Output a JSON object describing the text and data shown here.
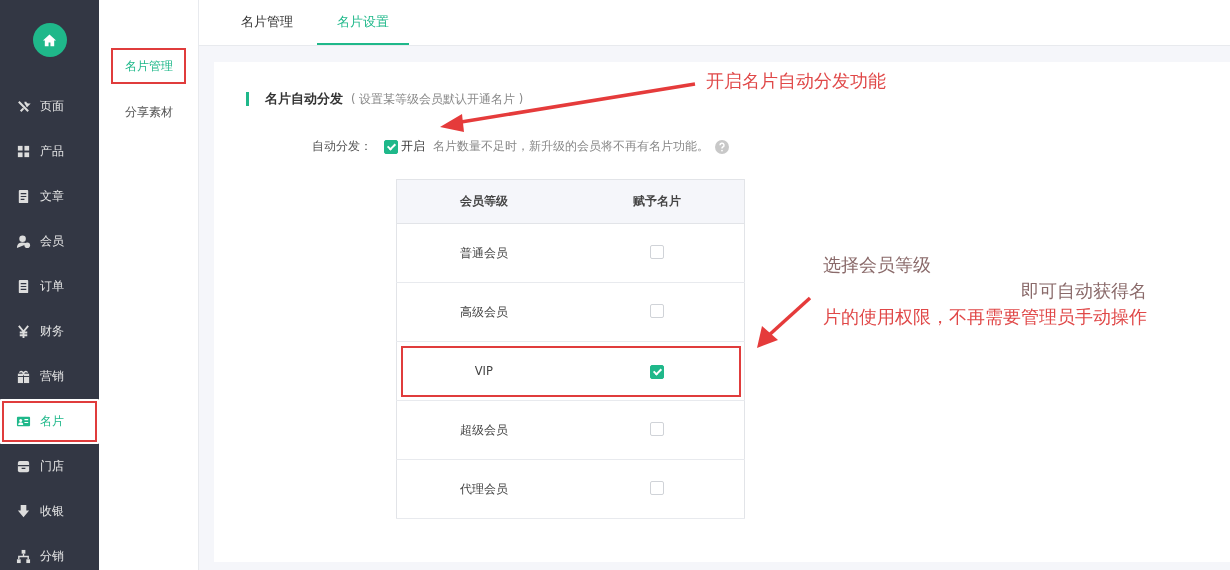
{
  "sidebar": {
    "items": [
      {
        "label": "页面",
        "selected": false,
        "annotated": false
      },
      {
        "label": "产品",
        "selected": false,
        "annotated": false
      },
      {
        "label": "文章",
        "selected": false,
        "annotated": false
      },
      {
        "label": "会员",
        "selected": false,
        "annotated": false
      },
      {
        "label": "订单",
        "selected": false,
        "annotated": false
      },
      {
        "label": "财务",
        "selected": false,
        "annotated": false
      },
      {
        "label": "营销",
        "selected": false,
        "annotated": false
      },
      {
        "label": "名片",
        "selected": true,
        "annotated": true
      },
      {
        "label": "门店",
        "selected": false,
        "annotated": false
      },
      {
        "label": "收银",
        "selected": false,
        "annotated": false
      },
      {
        "label": "分销",
        "selected": false,
        "annotated": false
      }
    ]
  },
  "submenu": {
    "items": [
      {
        "label": "名片管理",
        "selected": true,
        "annotated": true
      },
      {
        "label": "分享素材",
        "selected": false,
        "annotated": false
      }
    ]
  },
  "tabs": [
    {
      "label": "名片管理",
      "selected": false
    },
    {
      "label": "名片设置",
      "selected": true
    }
  ],
  "section": {
    "title": "名片自动分发",
    "hint": "( 设置某等级会员默认开通名片 )"
  },
  "auto_distribute": {
    "label": "自动分发：",
    "checked": true,
    "option": "开启",
    "note": "名片数量不足时，新升级的会员将不再有名片功能。"
  },
  "table": {
    "columns": [
      "会员等级",
      "赋予名片"
    ],
    "rows": [
      {
        "level": "普通会员",
        "checked": false,
        "annotated": false
      },
      {
        "level": "高级会员",
        "checked": false,
        "annotated": false
      },
      {
        "level": "VIP",
        "checked": true,
        "annotated": true
      },
      {
        "level": "超级会员",
        "checked": false,
        "annotated": false
      },
      {
        "level": "代理会员",
        "checked": false,
        "annotated": false
      }
    ]
  },
  "annotations": [
    {
      "lines": [
        "开启名片自动分发功能"
      ]
    },
    {
      "lines": [
        "选择会员等级",
        "即可自动获得名",
        "片的使用权限，不再需要管理员手动操作"
      ]
    }
  ]
}
